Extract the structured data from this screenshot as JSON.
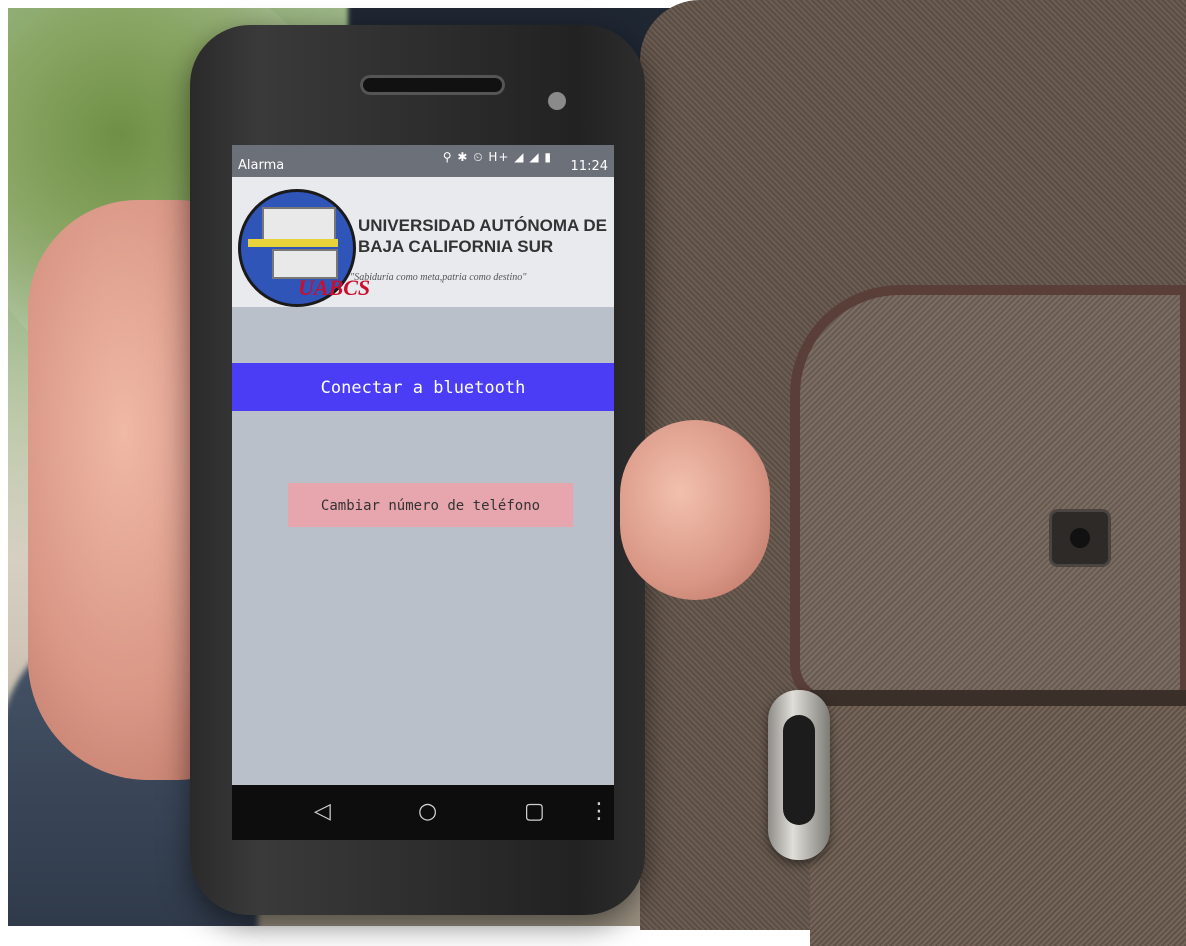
{
  "status_bar": {
    "app_title": "Alarma",
    "icons": "⚲ ✱ ⏲ H+ ◢ ◢ ▮",
    "time": "11:24"
  },
  "logo": {
    "university_name": "UNIVERSIDAD AUTÓNOMA DE BAJA CALIFORNIA SUR",
    "motto": "\"Sabiduría como meta,patria como destino\"",
    "acronym": "UABCS"
  },
  "buttons": {
    "connect_bluetooth": "Conectar a bluetooth",
    "change_phone_number": "Cambiar número de teléfono"
  },
  "nav_bar": {
    "back": "◁",
    "home": "○",
    "recents": "▢",
    "menu": "⋮"
  }
}
